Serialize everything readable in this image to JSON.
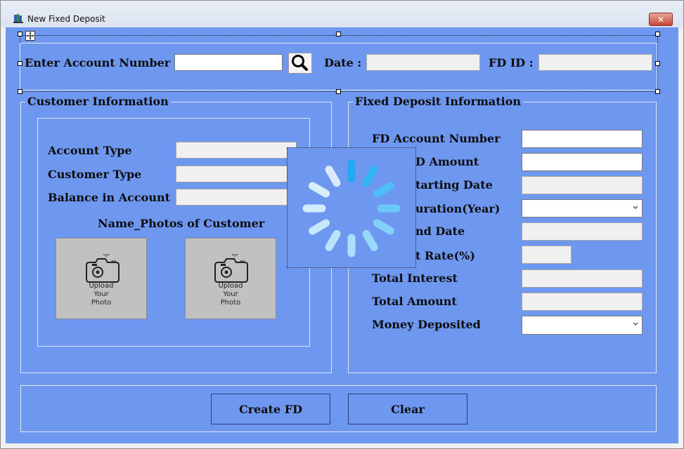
{
  "window": {
    "title": "New Fixed Deposit",
    "close_glyph": "✕"
  },
  "search_bar": {
    "account_label": "Enter Account Number :",
    "account_value": "",
    "date_label": "Date :",
    "date_value": "",
    "fdid_label": "FD ID :",
    "fdid_value": "",
    "search_icon": "search-icon"
  },
  "customer_info": {
    "legend": "Customer Information",
    "account_type_label": "Account Type",
    "customer_type_label": "Customer Type",
    "balance_label": "Balance in Account",
    "photos_label": "Name_Photos of Customer",
    "photo_caption": [
      "Upload",
      "Your",
      "Photo"
    ]
  },
  "fd_info": {
    "legend": "Fixed Deposit Information",
    "fields": [
      {
        "label": "FD Account Number"
      },
      {
        "label": "D Amount"
      },
      {
        "label": "tarting Date"
      },
      {
        "label": "uration(Year)"
      },
      {
        "label": "nd Date"
      },
      {
        "label": "t Rate(%)"
      },
      {
        "label": "Total Interest"
      },
      {
        "label": "Total Amount"
      },
      {
        "label": "Money Deposited"
      }
    ]
  },
  "buttons": {
    "create": "Create FD",
    "clear": "Clear"
  },
  "colors": {
    "client_bg": "#6e97ef",
    "spinner_bright": "#22a8f4",
    "spinner_faded": "#dbeafb"
  },
  "icons": [
    "app-icon",
    "close-icon",
    "search-icon",
    "move-icon",
    "camera-icon",
    "chevron-down-icon",
    "loading-spinner-icon"
  ]
}
